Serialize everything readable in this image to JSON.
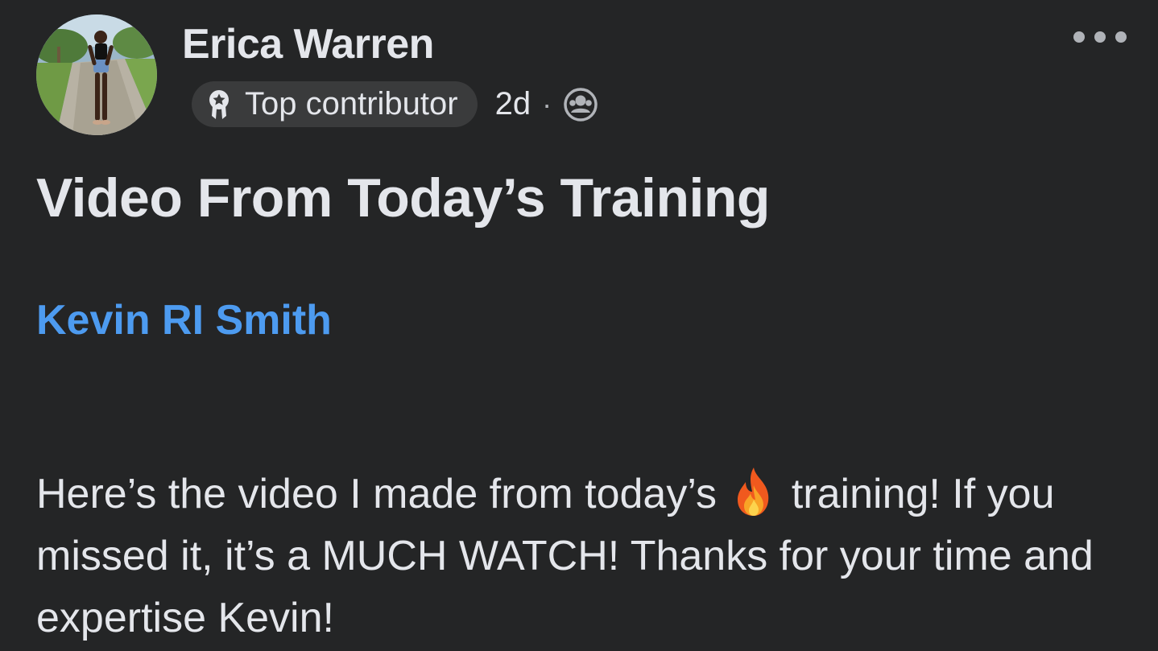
{
  "author": {
    "name": "Erica Warren"
  },
  "meta": {
    "badge_label": "Top contributor",
    "badge_icon": "award-ribbon-icon",
    "timestamp": "2d",
    "separator": "·",
    "audience_icon": "group-members-icon"
  },
  "post": {
    "title": "Video From Today’s Training",
    "mention": "Kevin RI Smith",
    "body_before_emoji": "Here’s the video I made from today’s",
    "emoji_icon": "fire-emoji-icon",
    "body_after_emoji": "training! If you missed it, it’s a MUCH WATCH! Thanks for your time and expertise Kevin!"
  },
  "colors": {
    "background": "#242526",
    "text": "#e4e6eb",
    "badge_bg": "#3a3b3c",
    "mention": "#4d9bf0"
  }
}
